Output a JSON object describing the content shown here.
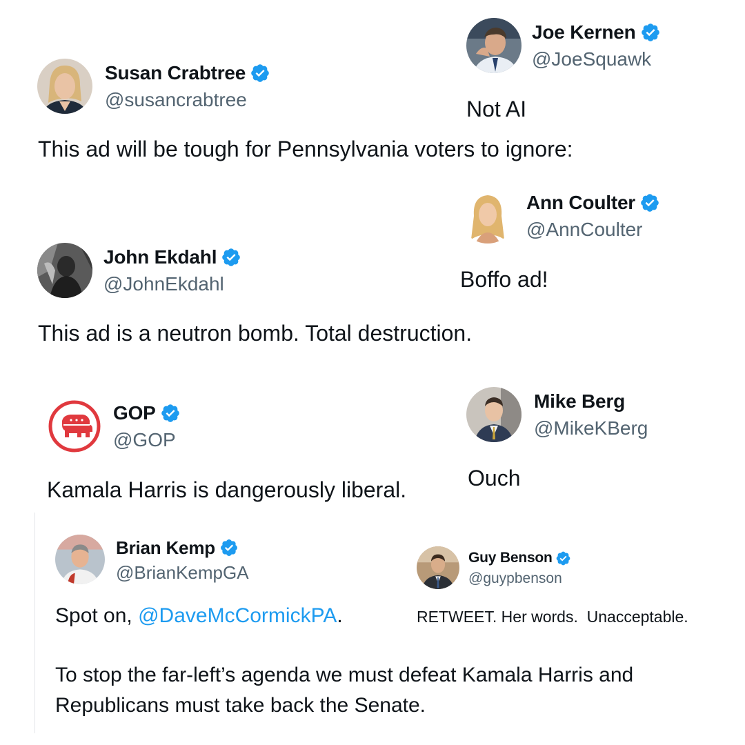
{
  "tweets": {
    "crabtree": {
      "name": "Susan Crabtree",
      "handle": "@susancrabtree",
      "text": "This ad will be tough for Pennsylvania voters to ignore:"
    },
    "kernen": {
      "name": "Joe Kernen",
      "handle": "@JoeSquawk",
      "text": "Not AI"
    },
    "coulter": {
      "name": "Ann Coulter",
      "handle": "@AnnCoulter",
      "text": "Boffo ad!"
    },
    "ekdahl": {
      "name": "John Ekdahl",
      "handle": "@JohnEkdahl",
      "text": "This ad is a neutron bomb. Total destruction."
    },
    "gop": {
      "name": "GOP",
      "handle": "@GOP",
      "text": "Kamala Harris is dangerously liberal."
    },
    "berg": {
      "name": "Mike Berg",
      "handle": "@MikeKBerg",
      "text": "Ouch"
    },
    "kemp": {
      "name": "Brian Kemp",
      "handle": "@BrianKempGA",
      "text_prefix": "Spot on, ",
      "mention": "@DaveMcCormickPA",
      "text_suffix": ".",
      "text_line2": "To stop the far-left’s agenda we must defeat Kamala Harris and",
      "text_line3": "Republicans must take back the Senate."
    },
    "benson": {
      "name": "Guy Benson",
      "handle": "@guypbenson",
      "text": "RETWEET. Her words.  Unacceptable."
    }
  },
  "colors": {
    "verified_badge": "#1d9bf0",
    "handle": "#536471",
    "mention": "#1d9bf0",
    "gop_red": "#e0393e"
  },
  "icons": {
    "verified": "verified-badge-icon",
    "gop_logo": "gop-elephant-icon"
  }
}
